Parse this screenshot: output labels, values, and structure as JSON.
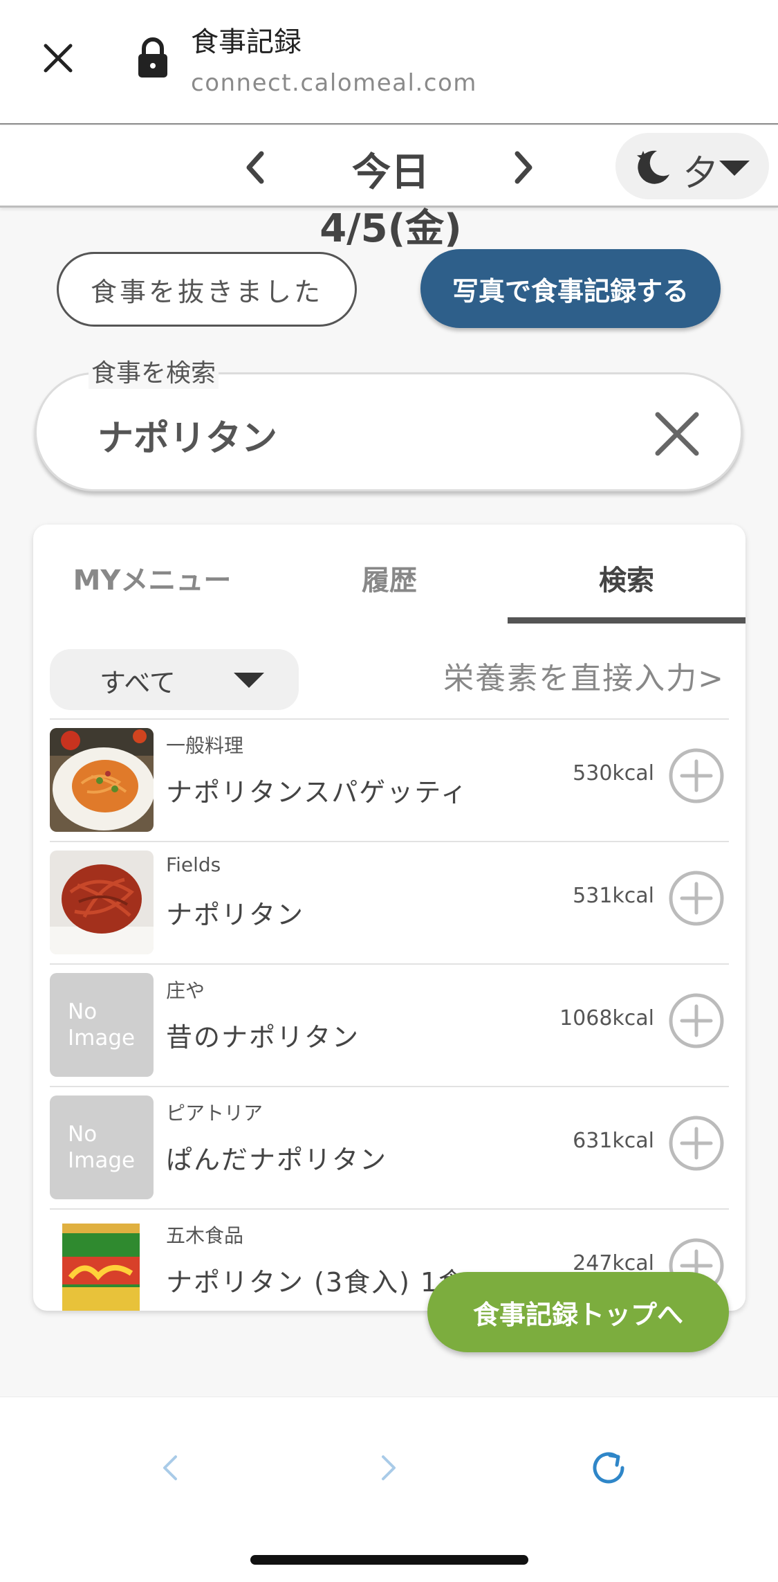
{
  "browser": {
    "title": "食事記録",
    "url": "connect.calomeal.com",
    "icons": [
      "close-icon",
      "lock-icon"
    ]
  },
  "date_header": {
    "date": "今日4/5(金)",
    "meal": "夕",
    "meal_icon": "moon-star-icon"
  },
  "actions": {
    "skip_label": "食事を抜きました",
    "photo_label": "写真で食事記録する"
  },
  "search": {
    "label": "食事を検索",
    "value": "ナポリタン"
  },
  "tabs": [
    {
      "label": "MYメニュー",
      "active": false
    },
    {
      "label": "履歴",
      "active": false
    },
    {
      "label": "検索",
      "active": true
    }
  ],
  "filter": {
    "selected": "すべて",
    "nutrient_link": "栄養素を直接入力>"
  },
  "results": [
    {
      "brand": "一般料理",
      "name": "ナポリタンスパゲッティ",
      "kcal": "530kcal",
      "image": "photo"
    },
    {
      "brand": "Fields",
      "name": "ナポリタン",
      "kcal": "531kcal",
      "image": "photo"
    },
    {
      "brand": "庄や",
      "name": "昔のナポリタン",
      "kcal": "1068kcal",
      "image": "none"
    },
    {
      "brand": "ピアトリア",
      "name": "ぱんだナポリタン",
      "kcal": "631kcal",
      "image": "none"
    },
    {
      "brand": "五木食品",
      "name": "ナポリタン (3食入) 1食",
      "kcal": "247kcal",
      "image": "package"
    }
  ],
  "no_image_text": [
    "No",
    "Image"
  ],
  "floating_button": "食事記録トップへ",
  "colors": {
    "primary_blue": "#2e5f8a",
    "accent_green": "#7cad3e",
    "nav_blue": "#2f86c8"
  }
}
